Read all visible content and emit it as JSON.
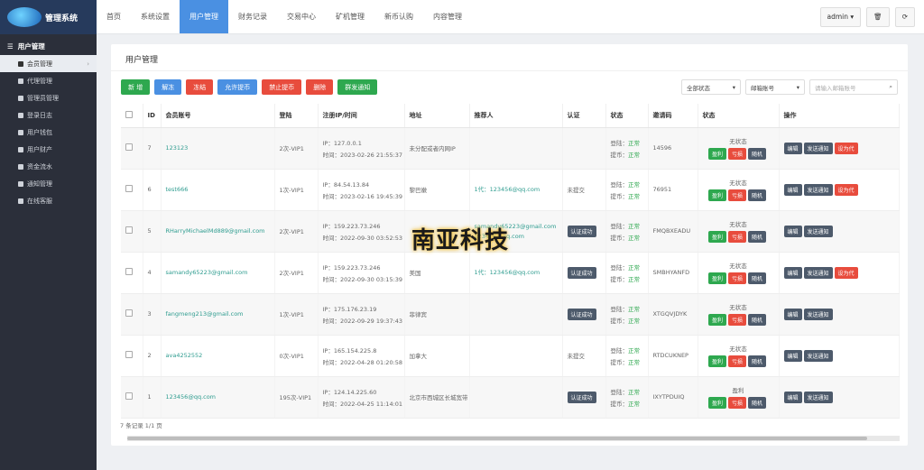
{
  "app": {
    "title": "管理系统"
  },
  "sidebar": {
    "section": "用户管理",
    "items": [
      {
        "label": "会员管理",
        "active": true
      },
      {
        "label": "代理管理"
      },
      {
        "label": "管理员管理"
      },
      {
        "label": "登录日志"
      },
      {
        "label": "用户钱包"
      },
      {
        "label": "用户财产"
      },
      {
        "label": "资金流水"
      },
      {
        "label": "通知管理"
      },
      {
        "label": "在线客服"
      }
    ]
  },
  "topnav": {
    "tabs": [
      "首页",
      "系统设置",
      "用户管理",
      "财务记录",
      "交易中心",
      "矿机管理",
      "新币认购",
      "内容管理"
    ],
    "active": 2,
    "user": "admin"
  },
  "panel": {
    "title": "用户管理"
  },
  "toolbar": {
    "buttons": [
      {
        "label": "新 增",
        "color": "#2ea84f"
      },
      {
        "label": "解冻",
        "color": "#4a90e2"
      },
      {
        "label": "冻结",
        "color": "#e84c3d"
      },
      {
        "label": "允许提币",
        "color": "#4a90e2"
      },
      {
        "label": "禁止提币",
        "color": "#e84c3d"
      },
      {
        "label": "删除",
        "color": "#e84c3d"
      },
      {
        "label": "群发通知",
        "color": "#2ea84f"
      }
    ]
  },
  "filters": {
    "status": "全部状态",
    "type": "邮箱账号",
    "search_placeholder": "请输入邮箱账号"
  },
  "table": {
    "headers": [
      "",
      "ID",
      "会员账号",
      "登陆",
      "注册IP/时间",
      "地址",
      "推荐人",
      "认证",
      "状态",
      "邀请码",
      "状态",
      "操作"
    ],
    "rows": [
      {
        "id": "7",
        "account": "123123",
        "login": "2次-VIP1",
        "ip": "IP：127.0.0.1",
        "time": "时间：2023-02-26 21:55:37",
        "addr": "未分配或者内网IP",
        "ref1": "",
        "ref2": "",
        "auth": "",
        "s1": "登陆：",
        "s1v": "正常",
        "s2": "提币：",
        "s2v": "正常",
        "code": "14596",
        "st": "无状态",
        "extra": true
      },
      {
        "id": "6",
        "account": "test666",
        "login": "1次-VIP1",
        "ip": "IP：84.54.13.84",
        "time": "时间：2023-02-16 19:45:39",
        "addr": "黎巴嫩",
        "ref1": "1代：123456@qq.com",
        "ref2": "",
        "auth": "未提交",
        "s1": "登陆：",
        "s1v": "正常",
        "s2": "提币：",
        "s2v": "正常",
        "code": "76951",
        "st": "无状态",
        "extra": true
      },
      {
        "id": "5",
        "account": "RHarryMichaelMd889@gmail.com",
        "login": "2次-VIP1",
        "ip": "IP：159.223.73.246",
        "time": "时间：2022-09-30 03:52:53",
        "addr": "",
        "ref1": "samandy65223@gmail.com",
        "ref2": "123456@qq.com",
        "auth": "认证成功",
        "s1": "登陆：",
        "s1v": "正常",
        "s2": "提币：",
        "s2v": "正常",
        "code": "FMQBXEADU",
        "st": "无状态",
        "extra": false
      },
      {
        "id": "4",
        "account": "samandy65223@gmail.com",
        "login": "2次-VIP1",
        "ip": "IP：159.223.73.246",
        "time": "时间：2022-09-30 03:15:39",
        "addr": "美国",
        "ref1": "1代：123456@qq.com",
        "ref2": "",
        "auth": "认证成功",
        "s1": "登陆：",
        "s1v": "正常",
        "s2": "提币：",
        "s2v": "正常",
        "code": "SMBHYANFD",
        "st": "无状态",
        "extra": true
      },
      {
        "id": "3",
        "account": "fangmeng213@gmail.com",
        "login": "1次-VIP1",
        "ip": "IP：175.176.23.19",
        "time": "时间：2022-09-29 19:37:43",
        "addr": "菲律宾",
        "ref1": "",
        "ref2": "",
        "auth": "认证成功",
        "s1": "登陆：",
        "s1v": "正常",
        "s2": "提币：",
        "s2v": "正常",
        "code": "XTGQVJDYK",
        "st": "无状态",
        "extra": false
      },
      {
        "id": "2",
        "account": "ava4252552",
        "login": "0次-VIP1",
        "ip": "IP：165.154.225.8",
        "time": "时间：2022-04-28 01:20:58",
        "addr": "加拿大",
        "ref1": "",
        "ref2": "",
        "auth": "未提交",
        "s1": "登陆：",
        "s1v": "正常",
        "s2": "提币：",
        "s2v": "正常",
        "code": "RTDCUKNEP",
        "st": "无状态",
        "extra": false
      },
      {
        "id": "1",
        "account": "123456@qq.com",
        "login": "195次-VIP1",
        "ip": "IP：124.14.225.60",
        "time": "时间：2022-04-25 11:14:01",
        "addr": "北京市西城区长城宽带",
        "ref1": "",
        "ref2": "",
        "auth": "认证成功",
        "s1": "登陆：",
        "s1v": "正常",
        "s2": "提币：",
        "s2v": "正常",
        "code": "IXYTPDUIQ",
        "st": "盈利",
        "extra": false
      }
    ],
    "action_labels": {
      "profit": "盈利",
      "loss": "亏损",
      "random": "随机",
      "edit": "编辑",
      "notify": "发送通知",
      "set": "设为代"
    }
  },
  "footer": {
    "count": "7 条记录 1/1 页"
  },
  "watermark": "南亚科技"
}
